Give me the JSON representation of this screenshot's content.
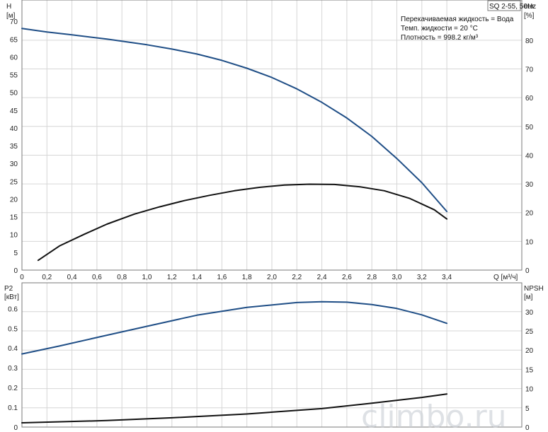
{
  "model_label": "SQ 2-55, 50Hz",
  "info_lines": [
    "Перекачиваемая жидкость = Вода",
    "Темп. жидкости = 20 °C",
    "Плотность = 998.2 кг/м³"
  ],
  "watermark": "climbo.ru",
  "colors": {
    "blue_series": "#1f4e86",
    "black_series": "#111111",
    "grid": "#d6d6d6"
  },
  "chart_data": [
    {
      "type": "line",
      "title": "",
      "xlabel": "Q [м³/ч]",
      "ylabel": "H [м]",
      "y2label": "eta [%]",
      "xlim": [
        0,
        4.0
      ],
      "ylim": [
        0,
        76
      ],
      "y2lim": [
        0,
        94
      ],
      "xticks": [
        0,
        0.2,
        0.4,
        0.6,
        0.8,
        1.0,
        1.2,
        1.4,
        1.6,
        1.8,
        2.0,
        2.2,
        2.4,
        2.6,
        2.8,
        3.0,
        3.2,
        3.4
      ],
      "xtick_labels": [
        "0",
        "0,2",
        "0,4",
        "0,6",
        "0,8",
        "1,0",
        "1,2",
        "1,4",
        "1,6",
        "1,8",
        "2,0",
        "2,2",
        "2,4",
        "2,6",
        "2,8",
        "3,0",
        "3,2",
        "3,4"
      ],
      "yticks": [
        0,
        5,
        10,
        15,
        20,
        25,
        30,
        35,
        40,
        45,
        50,
        55,
        60,
        65,
        70
      ],
      "y2ticks": [
        0,
        10,
        20,
        30,
        40,
        50,
        60,
        70,
        80
      ],
      "grid": true,
      "series": [
        {
          "name": "H",
          "axis": "left",
          "color": "#1f4e86",
          "x": [
            0,
            0.2,
            0.4,
            0.68,
            1.0,
            1.2,
            1.4,
            1.6,
            1.8,
            2.0,
            2.2,
            2.4,
            2.6,
            2.8,
            3.0,
            3.2,
            3.4
          ],
          "y": [
            68,
            67,
            66.2,
            65,
            63.4,
            62.2,
            60.8,
            59,
            56.8,
            54.2,
            51,
            47.2,
            42.8,
            37.6,
            31.4,
            24.6,
            16.5
          ]
        },
        {
          "name": "eta",
          "axis": "right",
          "color": "#111111",
          "x": [
            0.13,
            0.3,
            0.5,
            0.68,
            0.9,
            1.1,
            1.3,
            1.5,
            1.7,
            1.9,
            2.1,
            2.3,
            2.5,
            2.7,
            2.9,
            3.1,
            3.3,
            3.4
          ],
          "y": [
            3.4,
            8.4,
            12.5,
            16,
            19.5,
            22,
            24.2,
            26,
            27.6,
            28.8,
            29.6,
            29.9,
            29.8,
            29,
            27.6,
            25,
            21,
            17.8
          ]
        }
      ]
    },
    {
      "type": "line",
      "title": "",
      "xlabel": "",
      "ylabel": "P2 [кВт]",
      "y2label": "NPSH [м]",
      "xlim": [
        0,
        4.0
      ],
      "ylim": [
        0,
        0.73
      ],
      "y2lim": [
        0,
        37.5
      ],
      "yticks": [
        0,
        0.1,
        0.2,
        0.3,
        0.4,
        0.5,
        0.6
      ],
      "ytick_labels": [
        "0",
        "0.1",
        "0.2",
        "0.3",
        "0.4",
        "0.5",
        "0.6"
      ],
      "y2ticks": [
        0,
        5,
        10,
        15,
        20,
        25,
        30
      ],
      "grid": true,
      "series": [
        {
          "name": "P2",
          "axis": "left",
          "color": "#1f4e86",
          "x": [
            0,
            0.3,
            0.68,
            1.0,
            1.4,
            1.8,
            2.2,
            2.4,
            2.6,
            2.8,
            3.0,
            3.2,
            3.4
          ],
          "y": [
            0.37,
            0.41,
            0.465,
            0.51,
            0.566,
            0.606,
            0.63,
            0.634,
            0.632,
            0.62,
            0.6,
            0.568,
            0.525
          ]
        },
        {
          "name": "NPSH",
          "axis": "right",
          "color": "#111111",
          "x": [
            0,
            0.68,
            1.2,
            1.8,
            2.4,
            2.8,
            3.2,
            3.4
          ],
          "y": [
            1.1,
            1.7,
            2.4,
            3.4,
            4.8,
            6.2,
            7.7,
            8.6
          ]
        }
      ]
    }
  ]
}
